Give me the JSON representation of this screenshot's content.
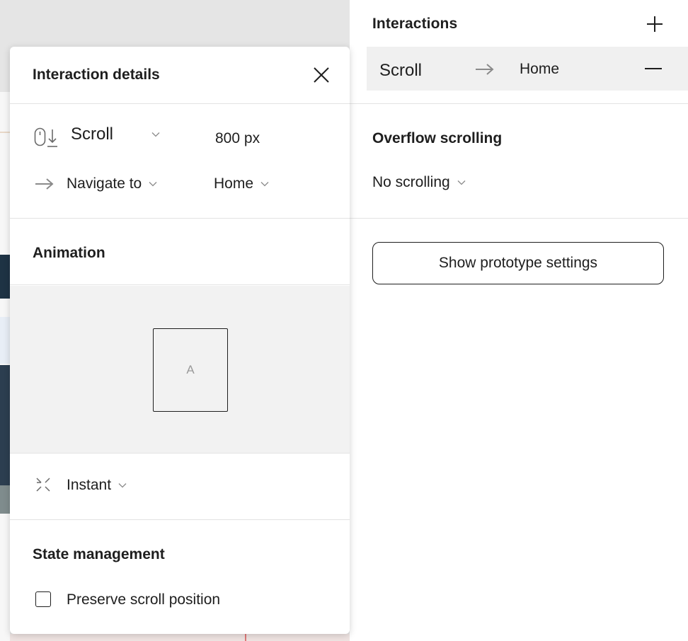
{
  "right_panel": {
    "interactions_title": "Interactions",
    "interaction": {
      "trigger": "Scroll",
      "destination": "Home"
    },
    "overflow_title": "Overflow scrolling",
    "overflow_value": "No scrolling",
    "prototype_button": "Show prototype settings"
  },
  "popover": {
    "title": "Interaction details",
    "trigger": {
      "label": "Scroll",
      "amount": "800",
      "unit": "px"
    },
    "action": {
      "label": "Navigate to",
      "destination": "Home"
    },
    "animation_title": "Animation",
    "preview_label": "A",
    "transition": "Instant",
    "state_title": "State management",
    "preserve_scroll_label": "Preserve scroll position",
    "preserve_scroll_checked": false
  },
  "colors": {
    "canvas": "#e5e5e5",
    "selected_row": "#f0f0f0",
    "animation_bg": "#f2f2f2",
    "text": "#1e1e1e",
    "muted": "#8a8a8a"
  },
  "icons": [
    "plus-icon",
    "arrow-right-icon",
    "minus-icon",
    "close-icon",
    "mouse-scroll-icon",
    "chevron-down-icon",
    "instant-transition-icon"
  ]
}
